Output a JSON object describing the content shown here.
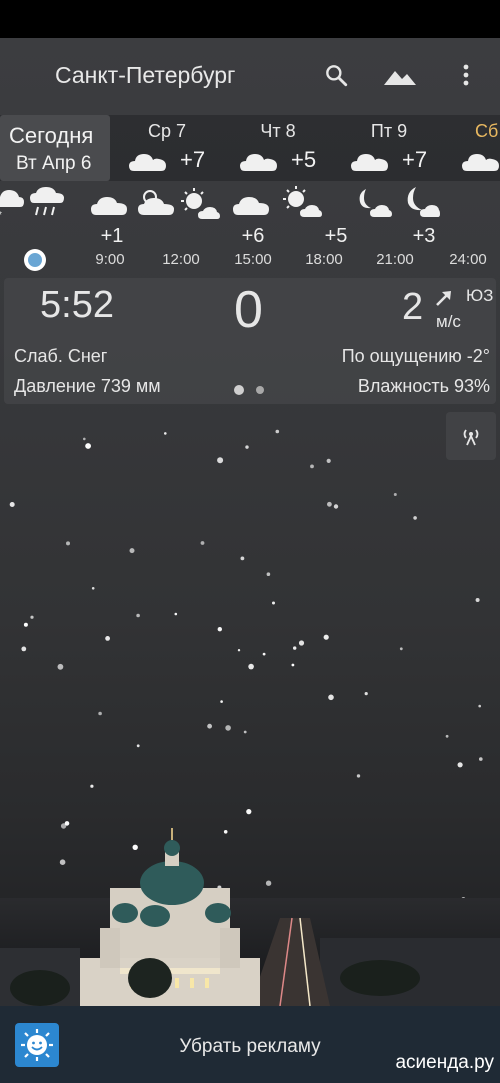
{
  "header": {
    "city": "Санкт-Петербург"
  },
  "icons": {
    "search": "search-icon",
    "background": "landscape-icon",
    "menu": "more-vert-icon"
  },
  "days": {
    "today": {
      "label": "Сегодня",
      "date": "Вт Апр 6"
    },
    "items": [
      {
        "label": "Ср 7",
        "temp": "+7",
        "icon": "cloud-icon"
      },
      {
        "label": "Чт 8",
        "temp": "+5",
        "icon": "cloud-icon"
      },
      {
        "label": "Пт 9",
        "temp": "+7",
        "icon": "cloud-icon"
      },
      {
        "label": "Сб",
        "icon": "cloud-icon"
      }
    ]
  },
  "hourly": {
    "temps": [
      "+1",
      "+6",
      "+5",
      "+3"
    ],
    "times": [
      "9:00",
      "12:00",
      "15:00",
      "18:00",
      "21:00",
      "24:00"
    ]
  },
  "current": {
    "time": "5:52",
    "temp": "0",
    "wind_speed": "2",
    "wind_dir": "ЮЗ",
    "wind_unit": "м/с",
    "condition": "Слаб. Снег",
    "feels_like": "По ощущению -2°",
    "pressure": "Давление 739 мм",
    "humidity": "Влажность 93%"
  },
  "ad": {
    "remove_label": "Убрать рекламу"
  },
  "watermark": "асиенда.ру",
  "colors": {
    "accent": "#6aa6d4",
    "sat_label": "#e8b860",
    "ad_bar": "#1f2a35"
  }
}
